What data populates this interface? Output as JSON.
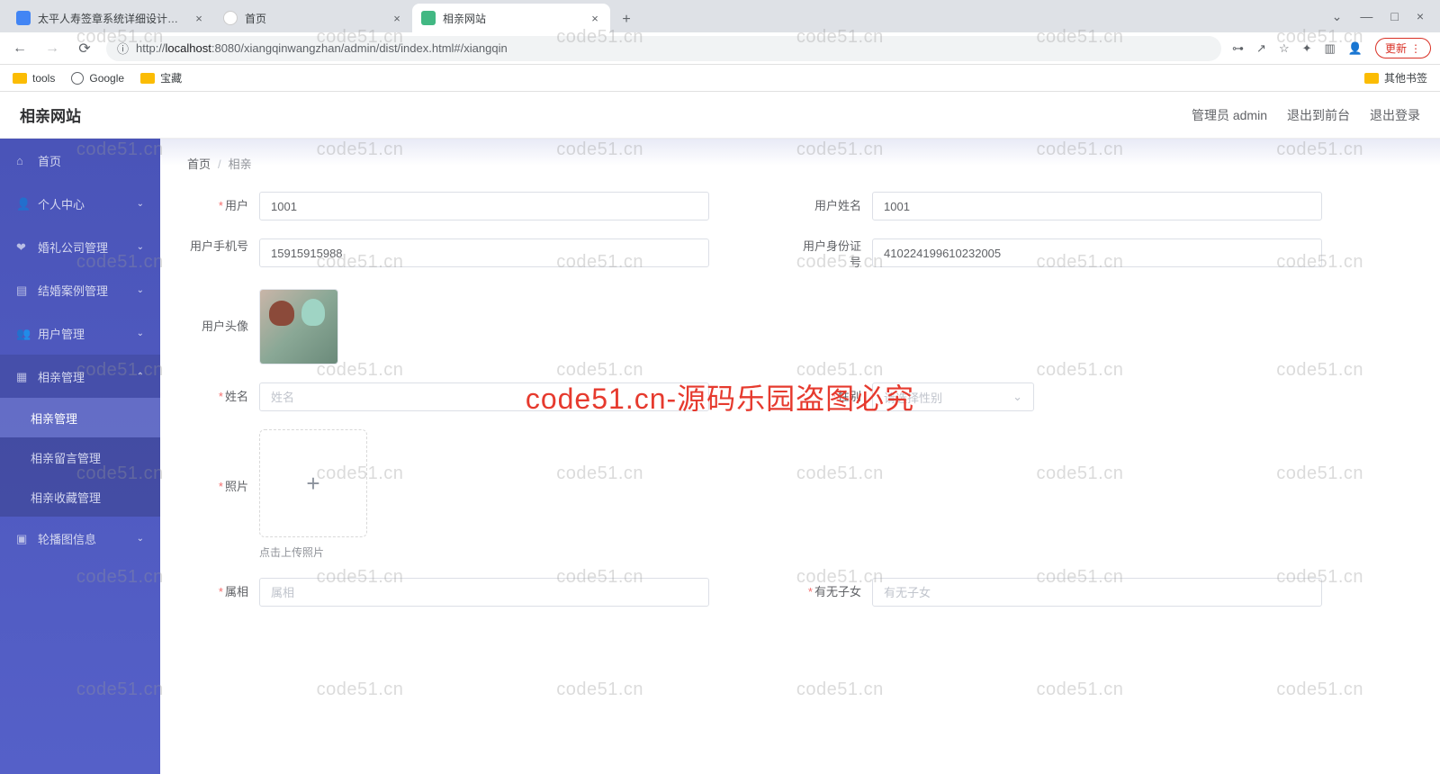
{
  "browser": {
    "tabs": [
      {
        "title": "太平人寿签章系统详细设计文档",
        "favicon": "#4285f4"
      },
      {
        "title": "首页",
        "favicon": "#888"
      },
      {
        "title": "相亲网站",
        "favicon": "#42b883"
      }
    ],
    "url_prefix": "http://",
    "url_host": "localhost",
    "url_rest": ":8080/xiangqinwangzhan/admin/dist/index.html#/xiangqin",
    "update_label": "更新",
    "bookmarks": [
      {
        "label": "tools",
        "type": "folder"
      },
      {
        "label": "Google",
        "type": "globe"
      },
      {
        "label": "宝藏",
        "type": "folder"
      }
    ],
    "other_bookmarks": "其他书签"
  },
  "header": {
    "app_title": "相亲网站",
    "user_role": "管理员 admin",
    "exit_front": "退出到前台",
    "logout": "退出登录"
  },
  "sidebar": {
    "items": [
      {
        "label": "首页",
        "icon": "home"
      },
      {
        "label": "个人中心",
        "icon": "user",
        "caret": "v"
      },
      {
        "label": "婚礼公司管理",
        "icon": "heart",
        "caret": "v"
      },
      {
        "label": "结婚案例管理",
        "icon": "layers",
        "caret": "v"
      },
      {
        "label": "用户管理",
        "icon": "users",
        "caret": "v"
      },
      {
        "label": "相亲管理",
        "icon": "grid",
        "caret": "^",
        "expanded": true,
        "subs": [
          {
            "label": "相亲管理",
            "active": true
          },
          {
            "label": "相亲留言管理"
          },
          {
            "label": "相亲收藏管理"
          }
        ]
      },
      {
        "label": "轮播图信息",
        "icon": "image",
        "caret": "v"
      }
    ]
  },
  "breadcrumb": {
    "home": "首页",
    "current": "相亲"
  },
  "form": {
    "user_label": "用户",
    "user_value": "1001",
    "user_name_label": "用户姓名",
    "user_name_value": "1001",
    "phone_label": "用户手机号",
    "phone_value": "15915915988",
    "idcard_label": "用户身份证号",
    "idcard_value": "410224199610232005",
    "avatar_label": "用户头像",
    "name_label": "姓名",
    "name_placeholder": "姓名",
    "gender_label": "性别",
    "gender_placeholder": "请选择性别",
    "photo_label": "照片",
    "photo_hint": "点击上传照片",
    "zodiac_label": "属相",
    "zodiac_placeholder": "属相",
    "children_label": "有无子女",
    "children_placeholder": "有无子女"
  },
  "watermark": {
    "text": "code51.cn",
    "red": "code51.cn-源码乐园盗图必究"
  }
}
